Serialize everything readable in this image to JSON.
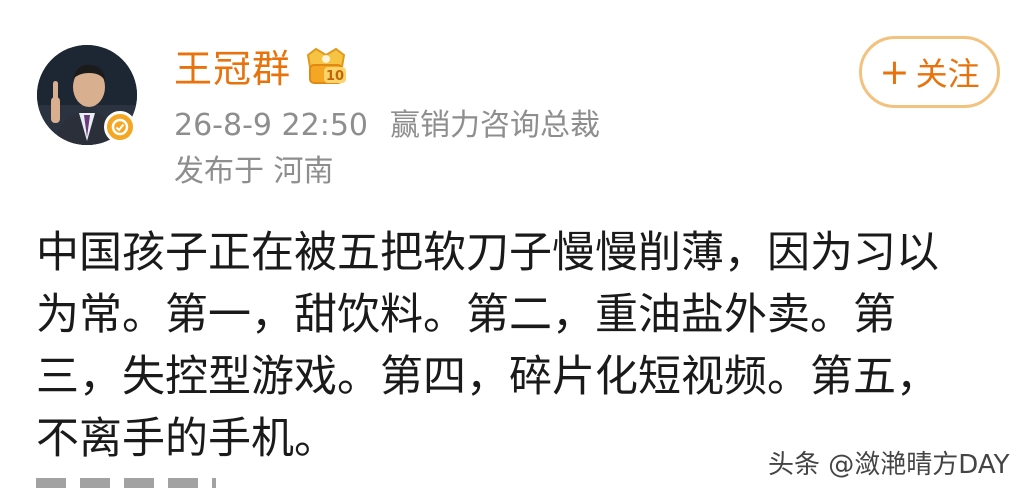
{
  "post": {
    "author": {
      "name": "王冠群",
      "avatar_icon": "person-avatar",
      "verified_icon": "verified-badge-icon",
      "level_badge": "10"
    },
    "timestamp": "26-8-9 22:50",
    "author_title": "赢销力咨询总裁",
    "location": "发布于 河南",
    "follow_button": {
      "plus": "+",
      "label": "关注"
    },
    "content_lines": [
      "中国孩子正在被五把软刀子慢慢削薄，因为习以",
      "为常。第一，甜饮料。第二，重油盐外卖。第",
      "三，失控型游戏。第四，碎片化短视频。第五，",
      "不离手的手机。"
    ]
  },
  "watermark": "头条 @潋滟晴方DAY",
  "colors": {
    "accent": "#e8720c",
    "follow_border": "#f3c27f",
    "meta_text": "#8e8e8e",
    "badge_gold": "#f5a623"
  }
}
